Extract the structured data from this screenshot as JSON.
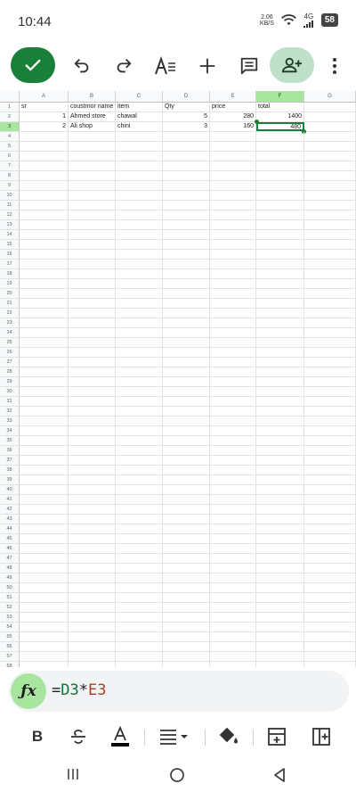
{
  "status_bar": {
    "time": "10:44",
    "net_speed_value": "2.06",
    "net_speed_unit": "KB/S",
    "signal_label": "4G",
    "battery": "58"
  },
  "toolbar": {
    "icons": [
      "check-icon",
      "undo-icon",
      "redo-icon",
      "text-format-icon",
      "add-icon",
      "comment-icon",
      "share-person-icon",
      "more-vert-icon"
    ]
  },
  "sheet": {
    "columns": [
      "A",
      "B",
      "C",
      "D",
      "E",
      "F",
      "G"
    ],
    "active_column": "F",
    "active_row": 3,
    "row_count": 58,
    "rows": [
      [
        "sr",
        "coustmor name",
        "item",
        "Qty",
        "price",
        "total",
        ""
      ],
      [
        "1",
        "Ahmed store",
        "chawal",
        "5",
        "280",
        "1400",
        ""
      ],
      [
        "2",
        "Ali shop",
        "chini",
        "3",
        "160",
        "480",
        ""
      ]
    ]
  },
  "formula": {
    "text": "=D3*E3",
    "ref1": "D3",
    "op": "*",
    "ref2": "E3",
    "ref1_color": "#137333",
    "ref2_color": "#a5432a",
    "icon": "fx-icon"
  },
  "format_bar": {
    "bold_label": "B",
    "items": [
      "bold-icon",
      "strikethrough-icon",
      "text-color-icon",
      "align-icon",
      "fill-color-icon",
      "insert-row-icon",
      "insert-column-icon"
    ]
  },
  "colors": {
    "accent": "#188038",
    "header_active": "#a8e6a0",
    "share_bg": "#bfe0c8"
  }
}
